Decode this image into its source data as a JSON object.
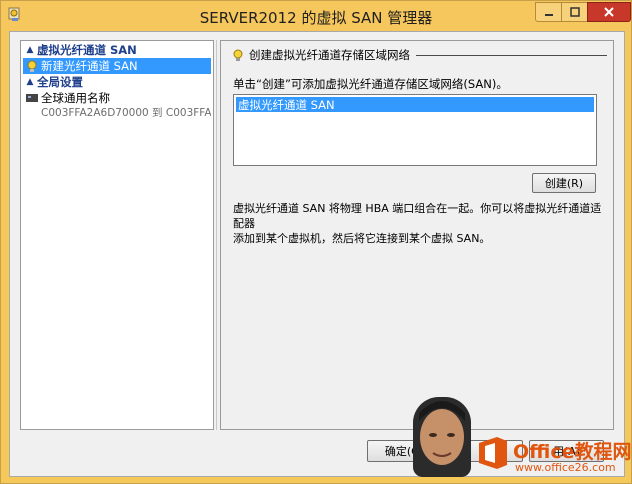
{
  "window": {
    "title": "SERVER2012 的虚拟 SAN 管理器"
  },
  "sidebar": {
    "group1": {
      "label": "虚拟光纤通道 SAN"
    },
    "selected_item": {
      "label": "新建光纤通道 SAN"
    },
    "group2": {
      "label": "全局设置"
    },
    "item": {
      "label": "全球通用名称",
      "detail": "C003FFA2A6D70000 到 C003FFA..."
    }
  },
  "main": {
    "section_title": "创建虚拟光纤通道存储区域网络",
    "instruction": "单击“创建”可添加虚拟光纤通道存储区域网络(SAN)。",
    "list_items": [
      "虚拟光纤通道 SAN"
    ],
    "create_label": "创建(R)",
    "description_line1": "虚拟光纤通道 SAN 将物理 HBA 端口组合在一起。你可以将虚拟光纤通道适配器",
    "description_line2": "添加到某个虚拟机，然后将它连接到某个虚拟 SAN。"
  },
  "footer": {
    "ok_label": "确定(O)",
    "cancel_label": "",
    "apply_label": "用(A)"
  },
  "watermark": {
    "brand": "Office教程网",
    "url": "www.office26.com"
  },
  "colors": {
    "titlebar": "#f6c75c",
    "selection": "#3399ff",
    "group_header": "#1e3f8c",
    "watermark": "#e0560f",
    "close_button": "#c7382b"
  }
}
